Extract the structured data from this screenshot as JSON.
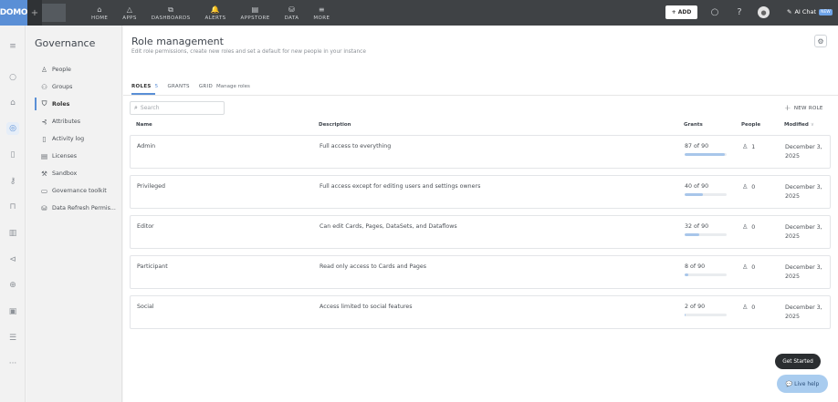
{
  "topbar": {
    "logo": "DOMO",
    "nav": [
      {
        "icon": "home-icon",
        "glyph": "⌂",
        "label": "HOME"
      },
      {
        "icon": "apps-icon",
        "glyph": "△",
        "label": "APPS"
      },
      {
        "icon": "dashboards-icon",
        "glyph": "⧉",
        "label": "DASHBOARDS"
      },
      {
        "icon": "alerts-icon",
        "glyph": "🔔",
        "label": "ALERTS"
      },
      {
        "icon": "appstore-icon",
        "glyph": "▤",
        "label": "APPSTORE"
      },
      {
        "icon": "data-icon",
        "glyph": "⛁",
        "label": "DATA"
      },
      {
        "icon": "more-icon",
        "glyph": "≡",
        "label": "MORE"
      }
    ],
    "add_label": "ADD",
    "ai_chat_label": "AI Chat",
    "ai_chat_badge": "NEW"
  },
  "sidebar": {
    "title": "Governance",
    "items": [
      {
        "icon": "person-icon",
        "glyph": "♙",
        "label": "People"
      },
      {
        "icon": "groups-icon",
        "glyph": "⚇",
        "label": "Groups"
      },
      {
        "icon": "shield-icon",
        "glyph": "⛉",
        "label": "Roles"
      },
      {
        "icon": "attributes-icon",
        "glyph": "⊰",
        "label": "Attributes"
      },
      {
        "icon": "activity-log-icon",
        "glyph": "▯",
        "label": "Activity log"
      },
      {
        "icon": "licenses-icon",
        "glyph": "▤",
        "label": "Licenses"
      },
      {
        "icon": "sandbox-icon",
        "glyph": "⚒",
        "label": "Sandbox"
      },
      {
        "icon": "toolkit-icon",
        "glyph": "▭",
        "label": "Governance toolkit"
      },
      {
        "icon": "data-refresh-icon",
        "glyph": "⛁",
        "label": "Data Refresh Permis..."
      }
    ]
  },
  "main": {
    "title": "Role management",
    "subtitle": "Edit role permissions, create new roles and set a default for new people in your instance",
    "tabs": {
      "roles": "ROLES",
      "roles_count": "5",
      "grants": "GRANTS",
      "grid": "GRID",
      "manage": "Manage roles"
    },
    "search_placeholder": "Search",
    "new_role_label": "NEW ROLE",
    "columns": {
      "name": "Name",
      "description": "Description",
      "grants": "Grants",
      "people": "People",
      "modified": "Modified"
    },
    "rows": [
      {
        "name": "Admin",
        "description": "Full access to everything",
        "grants": "87 of 90",
        "grants_fraction": 0.967,
        "people": "1",
        "modified": "December 3, 2025"
      },
      {
        "name": "Privileged",
        "description": "Full access except for editing users and settings owners",
        "grants": "40 of 90",
        "grants_fraction": 0.444,
        "people": "0",
        "modified": "December 3, 2025"
      },
      {
        "name": "Editor",
        "description": "Can edit Cards, Pages, DataSets, and Dataflows",
        "grants": "32 of 90",
        "grants_fraction": 0.356,
        "people": "0",
        "modified": "December 3, 2025"
      },
      {
        "name": "Participant",
        "description": "Read only access to Cards and Pages",
        "grants": "8 of 90",
        "grants_fraction": 0.089,
        "people": "0",
        "modified": "December 3, 2025"
      },
      {
        "name": "Social",
        "description": "Access limited to social features",
        "grants": "2 of 90",
        "grants_fraction": 0.022,
        "people": "0",
        "modified": "December 3, 2025"
      }
    ]
  },
  "widgets": {
    "get_started": "Get Started",
    "live_help": "Live help"
  },
  "colors": {
    "accent": "#5a8fd6",
    "topbar": "#3f4245",
    "grants_bar_fill": "#a8c6ea"
  }
}
